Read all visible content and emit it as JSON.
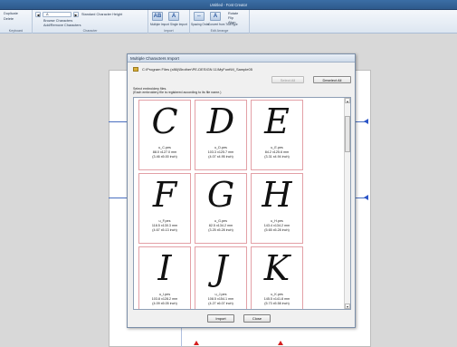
{
  "app": {
    "title": "Untitled - Font Creator"
  },
  "ribbon": {
    "groups": [
      {
        "label": "Keyboard"
      },
      {
        "label": "Character"
      },
      {
        "label": "Import"
      },
      {
        "label": "Edit Arrange"
      }
    ],
    "items": {
      "duplicate": "Duplicate",
      "delete": "Delete",
      "char_a": "A",
      "standard_height": "Standard Character Height",
      "browse_chars": "Browse Characters",
      "add_remove_chars": "Add/Remove Characters",
      "multiple_import": "Multiple Import",
      "single_import": "Single Import",
      "spacing_order": "Spacing Order",
      "convert_from_truetype": "Convert from TrueType",
      "rotate": "Rotate",
      "flip": "Flip",
      "align": "Align"
    }
  },
  "dialog": {
    "title": "Multiple Characters Import",
    "path": "C:\\Program Files (x86)\\Brother\\PE-DESIGN 11\\MyFont\\M_Sample05",
    "select_all": "Select All",
    "deselect_all": "Deselect All",
    "instruction_line1": "Select embroidery files.",
    "instruction_line2": "(Each embroidery file is registered according to its file name.)",
    "tiles": [
      {
        "glyph": "C",
        "file": "u_C.pes",
        "size": "88.0 x127.0 mm",
        "inch": "(3.46 x5.00 inch)"
      },
      {
        "glyph": "D",
        "file": "u_D.pes",
        "size": "103.3 x125.7 mm",
        "inch": "(4.07 x4.95 inch)"
      },
      {
        "glyph": "E",
        "file": "u_E.pes",
        "size": "84.2 x125.6 mm",
        "inch": "(3.31 x4.94 inch)"
      },
      {
        "glyph": "F",
        "file": "u_F.pes",
        "size": "118.5 x130.3 mm",
        "inch": "(4.67 x5.13 inch)"
      },
      {
        "glyph": "G",
        "file": "u_G.pes",
        "size": "82.5 x134.2 mm",
        "inch": "(3.25 x5.28 inch)"
      },
      {
        "glyph": "H",
        "file": "u_H.pes",
        "size": "143.4 x134.2 mm",
        "inch": "(5.65 x5.28 inch)"
      },
      {
        "glyph": "I",
        "file": "u_I.pes",
        "size": "103.8 x128.2 mm",
        "inch": "(4.09 x5.05 inch)"
      },
      {
        "glyph": "J",
        "file": "u_J.pes",
        "size": "108.5 x154.1 mm",
        "inch": "(4.27 x6.07 inch)"
      },
      {
        "glyph": "K",
        "file": "u_K.pes",
        "size": "145.5 x141.8 mm",
        "inch": "(5.73 x5.58 inch)"
      }
    ],
    "import_label": "Import",
    "close_label": "Close"
  },
  "colors": {
    "guide_blue": "#4a6fc0",
    "marker_blue": "#2b55c8",
    "marker_red": "#d42020",
    "tile_border": "#e3a0a6"
  }
}
